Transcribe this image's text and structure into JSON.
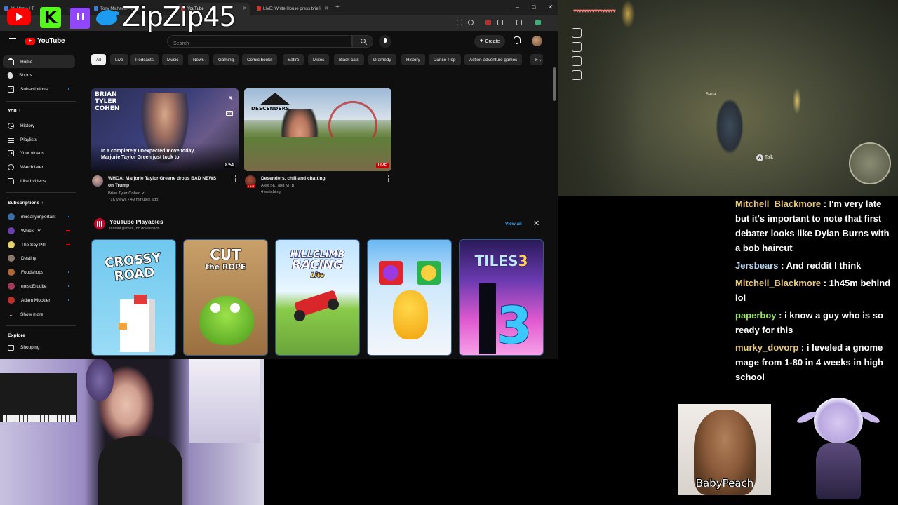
{
  "overlay": {
    "streamer_name": "ZipZip45",
    "brand_icons": [
      "youtube-icon",
      "kick-icon",
      "twitch-icon",
      "twitter-icon"
    ]
  },
  "browser": {
    "tabs": [
      {
        "label": "(3) Home / T",
        "favicon": "x-icon"
      },
      {
        "label": "Tony Michaels - Septi",
        "favicon": "x-icon"
      },
      {
        "label": "YouTube",
        "favicon": "youtube-icon",
        "active": true
      },
      {
        "label": "LIVE: White House press briefi",
        "favicon": "youtube-icon"
      }
    ]
  },
  "youtube": {
    "logo_text": "YouTube",
    "search_placeholder": "Search",
    "create_label": "Create",
    "sidebar": {
      "main": [
        {
          "label": "Home",
          "icon": "home-icon",
          "active": true
        },
        {
          "label": "Shorts",
          "icon": "shorts-icon"
        },
        {
          "label": "Subscriptions",
          "icon": "subscriptions-icon"
        }
      ],
      "you_heading": "You",
      "you": [
        {
          "label": "History",
          "icon": "history-icon"
        },
        {
          "label": "Playlists",
          "icon": "playlists-icon"
        },
        {
          "label": "Your videos",
          "icon": "your-videos-icon"
        },
        {
          "label": "Watch later",
          "icon": "watch-later-icon"
        },
        {
          "label": "Liked videos",
          "icon": "liked-videos-icon"
        }
      ],
      "subscriptions_heading": "Subscriptions",
      "subscriptions": [
        {
          "label": "imreallyimportant",
          "indicator": "dot"
        },
        {
          "label": "Whick TV",
          "indicator": "live"
        },
        {
          "label": "The Soy Pill",
          "indicator": "live"
        },
        {
          "label": "Destiny",
          "indicator": "none"
        },
        {
          "label": "Foodshops",
          "indicator": "dot"
        },
        {
          "label": "notsoErudite",
          "indicator": "dot"
        },
        {
          "label": "Adam Mockler",
          "indicator": "dot"
        }
      ],
      "show_more": "Show more",
      "explore_heading": "Explore",
      "explore": [
        {
          "label": "Shopping",
          "icon": "shopping-icon"
        }
      ]
    },
    "chips": [
      "All",
      "Live",
      "Podcasts",
      "Music",
      "News",
      "Gaming",
      "Comic books",
      "Satire",
      "Mixes",
      "Black cats",
      "Dramedy",
      "History",
      "Dance-Pop",
      "Action-adventure games",
      "F"
    ],
    "videos": [
      {
        "title_line1": "WHOA: Marjorie Taylor Greene drops BAD NEWS",
        "title_line2": "on Trump",
        "channel": "Brian Tyler Cohen",
        "meta": "71K views • 49 minutes ago",
        "duration": "8:54",
        "thumb_brand_line1": "BRIAN",
        "thumb_brand_line2": "TYLER",
        "thumb_brand_line3": "COHEN",
        "thumb_caption_line1": "In a completely unexpected move today,",
        "thumb_caption_line2": "Marjorie Taylor Green just took to"
      },
      {
        "title_line1": "Desenders, chill and chatting",
        "channel": "Alex SKI and MTB",
        "meta": "4 watching",
        "badge": "LIVE",
        "thumb_brand": "DESCENDERS"
      }
    ],
    "playables": {
      "title": "YouTube Playables",
      "subtitle": "Instant games, no downloads",
      "view_all": "View all",
      "games": [
        {
          "line1": "CROSSY",
          "line2": "ROAD"
        },
        {
          "line1": "CUT",
          "line2": "the ROPE"
        },
        {
          "line1": "HILLCLIMB",
          "line2": "RACING",
          "line3": "Lite"
        },
        {
          "line1": ""
        },
        {
          "line1": "TILES",
          "line2": "3"
        }
      ]
    }
  },
  "game_hud": {
    "npc_name": "Barta",
    "prompt_button": "A",
    "prompt": "Talk"
  },
  "chat": [
    {
      "user": "Mitchell_Blackmore",
      "color": "#e8c87a",
      "text": "I'm very late but it's important to note that first debater looks like Dylan Burns with a bob haircut"
    },
    {
      "user": "Jersbears",
      "color": "#b9d6f2",
      "text": "And reddit I think"
    },
    {
      "user": "Mitchell_Blackmore",
      "color": "#e8c87a",
      "text": "1h45m behind lol"
    },
    {
      "user": "paperboy",
      "color": "#9be36b",
      "text": "i know a guy who is so ready for this"
    },
    {
      "user": "murky_dovorp",
      "color": "#e8c87a",
      "text": "i leveled a gnome mage from 1-80 in 4 weeks in high school"
    }
  ],
  "avatars": {
    "babypeach_name": "BabyPeach"
  },
  "colors": {
    "yt_bg": "#0f0f0f",
    "yt_red": "#ff0000",
    "chip_bg": "#272727",
    "link_blue": "#3ea6ff"
  }
}
